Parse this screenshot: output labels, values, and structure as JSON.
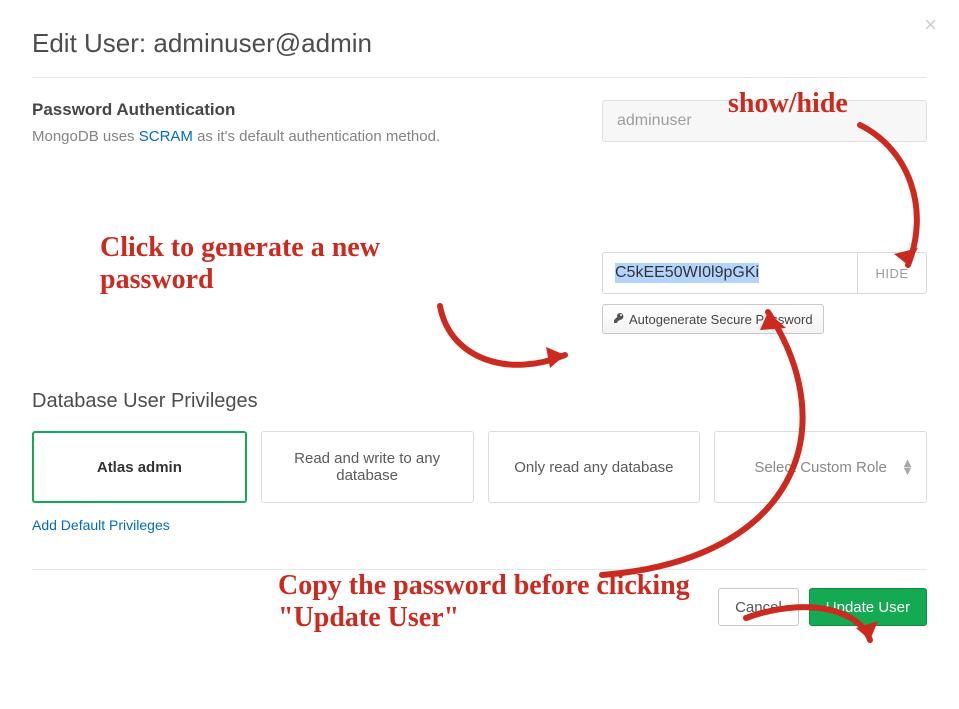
{
  "dialog": {
    "title": "Edit User: adminuser@admin"
  },
  "auth": {
    "section_title": "Password Authentication",
    "desc_prefix": "MongoDB uses ",
    "scram_link": "SCRAM",
    "desc_suffix": " as it's default authentication method.",
    "username_value": "adminuser",
    "password_value": "C5kEE50WI0l9pGKi",
    "hide_label": "HIDE",
    "autogen_label": "Autogenerate Secure Password"
  },
  "privileges": {
    "title": "Database User Privileges",
    "options": [
      {
        "label": "Atlas admin",
        "selected": true
      },
      {
        "label": "Read and write to any database",
        "selected": false
      },
      {
        "label": "Only read any database",
        "selected": false
      },
      {
        "label": "Select Custom Role",
        "selected": false,
        "custom": true
      }
    ],
    "add_default": "Add Default Privileges"
  },
  "footer": {
    "cancel": "Cancel",
    "submit": "Update User"
  },
  "annotations": {
    "show_hide": "show/hide",
    "click_generate": "Click to generate a new password",
    "copy_pw": "Copy the password before clicking \"Update User\""
  },
  "colors": {
    "accent_green": "#13aa52",
    "link_blue": "#006cbc",
    "anno_red": "#cc2a1f"
  }
}
